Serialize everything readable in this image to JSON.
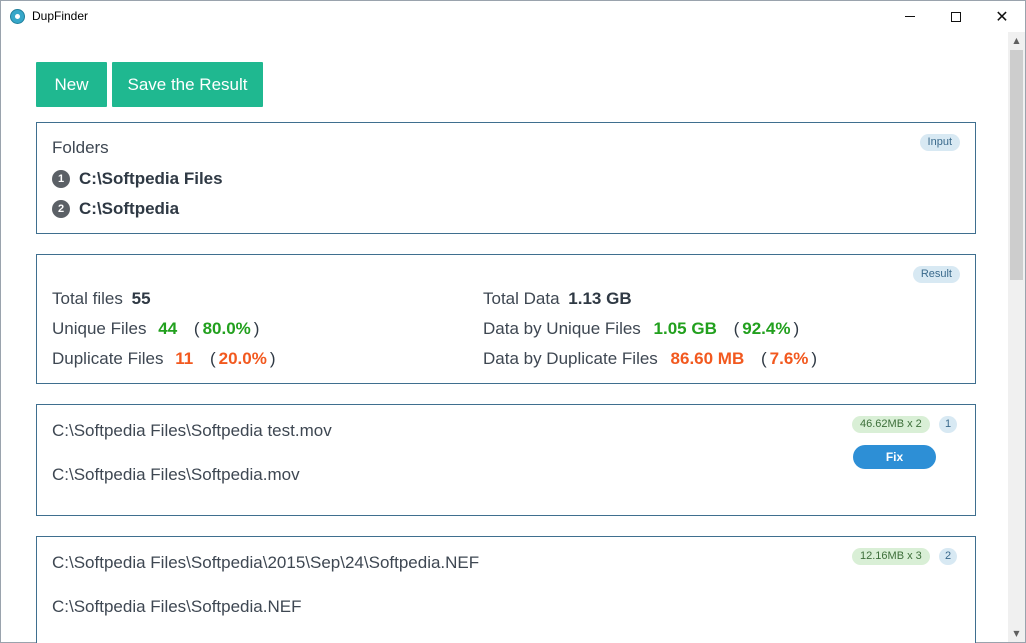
{
  "window": {
    "title": "DupFinder"
  },
  "toolbar": {
    "new_label": "New",
    "save_label": "Save the Result"
  },
  "input_panel": {
    "tag": "Input",
    "heading": "Folders",
    "folders": [
      {
        "num": "1",
        "path": "C:\\Softpedia Files"
      },
      {
        "num": "2",
        "path": "C:\\Softpedia"
      }
    ]
  },
  "result_panel": {
    "tag": "Result",
    "total_files_label": "Total files",
    "total_files_value": "55",
    "unique_files_label": "Unique Files",
    "unique_files_value": "44",
    "unique_files_pct": "80.0%",
    "duplicate_files_label": "Duplicate Files",
    "duplicate_files_value": "11",
    "duplicate_files_pct": "20.0%",
    "total_data_label": "Total Data",
    "total_data_value": "1.13 GB",
    "unique_data_label": "Data by Unique Files",
    "unique_data_value": "1.05 GB",
    "unique_data_pct": "92.4%",
    "duplicate_data_label": "Data by Duplicate Files",
    "duplicate_data_value": "86.60 MB",
    "duplicate_data_pct": "7.6%",
    "paren_open": "(",
    "paren_close": ")"
  },
  "duplicate_groups": [
    {
      "size_badge": "46.62MB x 2",
      "count_badge": "1",
      "fix_label": "Fix",
      "files": [
        "C:\\Softpedia Files\\Softpedia test.mov",
        "C:\\Softpedia Files\\Softpedia.mov"
      ]
    },
    {
      "size_badge": "12.16MB x 3",
      "count_badge": "2",
      "files": [
        "C:\\Softpedia Files\\Softpedia\\2015\\Sep\\24\\Softpedia.NEF",
        "C:\\Softpedia Files\\Softpedia.NEF"
      ]
    }
  ],
  "colors": {
    "accent_green": "#1fb890",
    "value_green": "#22a01e",
    "value_orange": "#f2591f",
    "fix_blue": "#2d8fd6",
    "panel_border": "#3f6f8f"
  }
}
